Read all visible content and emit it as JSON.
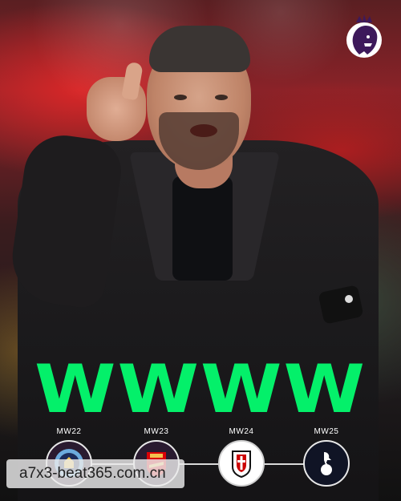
{
  "headline": "WWWW",
  "logo": {
    "icon": "premier-league-lion-icon"
  },
  "matches": [
    {
      "label": "MW22",
      "icon": "manchester-city-crest-icon"
    },
    {
      "label": "MW23",
      "icon": "arsenal-crest-icon"
    },
    {
      "label": "MW24",
      "icon": "fulham-crest-icon"
    },
    {
      "label": "MW25",
      "icon": "tottenham-crest-icon"
    }
  ],
  "watermark": "a7x3-beat365.com.cn",
  "colors": {
    "headline": "#04f06a",
    "logo_purple": "#3d195b",
    "badge_ring": "#e8e8e8"
  }
}
